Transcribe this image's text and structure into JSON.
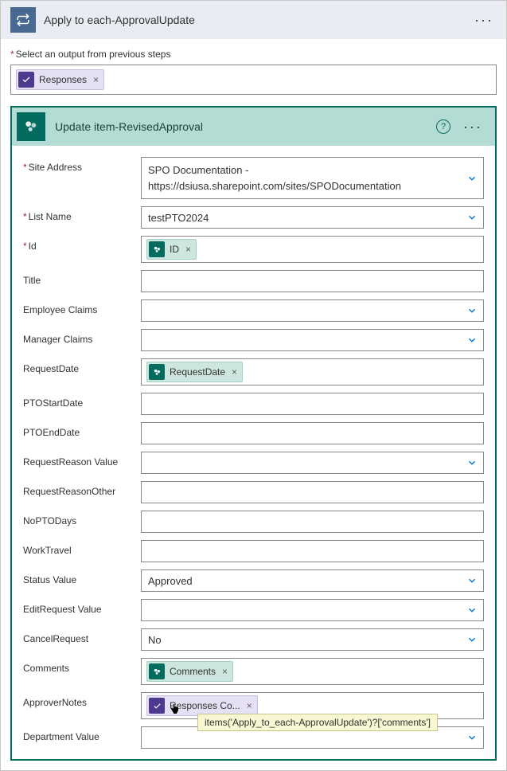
{
  "outer": {
    "title": "Apply to each-ApprovalUpdate",
    "selectOutputLabel": "Select an output from previous steps",
    "token": {
      "label": "Responses"
    }
  },
  "inner": {
    "title": "Update item-RevisedApproval",
    "fields": {
      "siteAddress": {
        "label": "Site Address",
        "line1": "SPO Documentation -",
        "line2": "https://dsiusa.sharepoint.com/sites/SPODocumentation"
      },
      "listName": {
        "label": "List Name",
        "value": "testPTO2024"
      },
      "id": {
        "label": "Id",
        "token": "ID"
      },
      "title": {
        "label": "Title"
      },
      "employeeClaims": {
        "label": "Employee Claims"
      },
      "managerClaims": {
        "label": "Manager Claims"
      },
      "requestDate": {
        "label": "RequestDate",
        "token": "RequestDate"
      },
      "ptoStartDate": {
        "label": "PTOStartDate"
      },
      "ptoEndDate": {
        "label": "PTOEndDate"
      },
      "requestReasonValue": {
        "label": "RequestReason Value"
      },
      "requestReasonOther": {
        "label": "RequestReasonOther"
      },
      "noPtoDays": {
        "label": "NoPTODays"
      },
      "workTravel": {
        "label": "WorkTravel"
      },
      "statusValue": {
        "label": "Status Value",
        "value": "Approved"
      },
      "editRequestValue": {
        "label": "EditRequest Value"
      },
      "cancelRequest": {
        "label": "CancelRequest",
        "value": "No"
      },
      "comments": {
        "label": "Comments",
        "token": "Comments"
      },
      "approverNotes": {
        "label": "ApproverNotes",
        "token": "Responses Co..."
      },
      "departmentValue": {
        "label": "Department Value"
      }
    }
  },
  "tooltip": "items('Apply_to_each-ApprovalUpdate')?['comments']"
}
